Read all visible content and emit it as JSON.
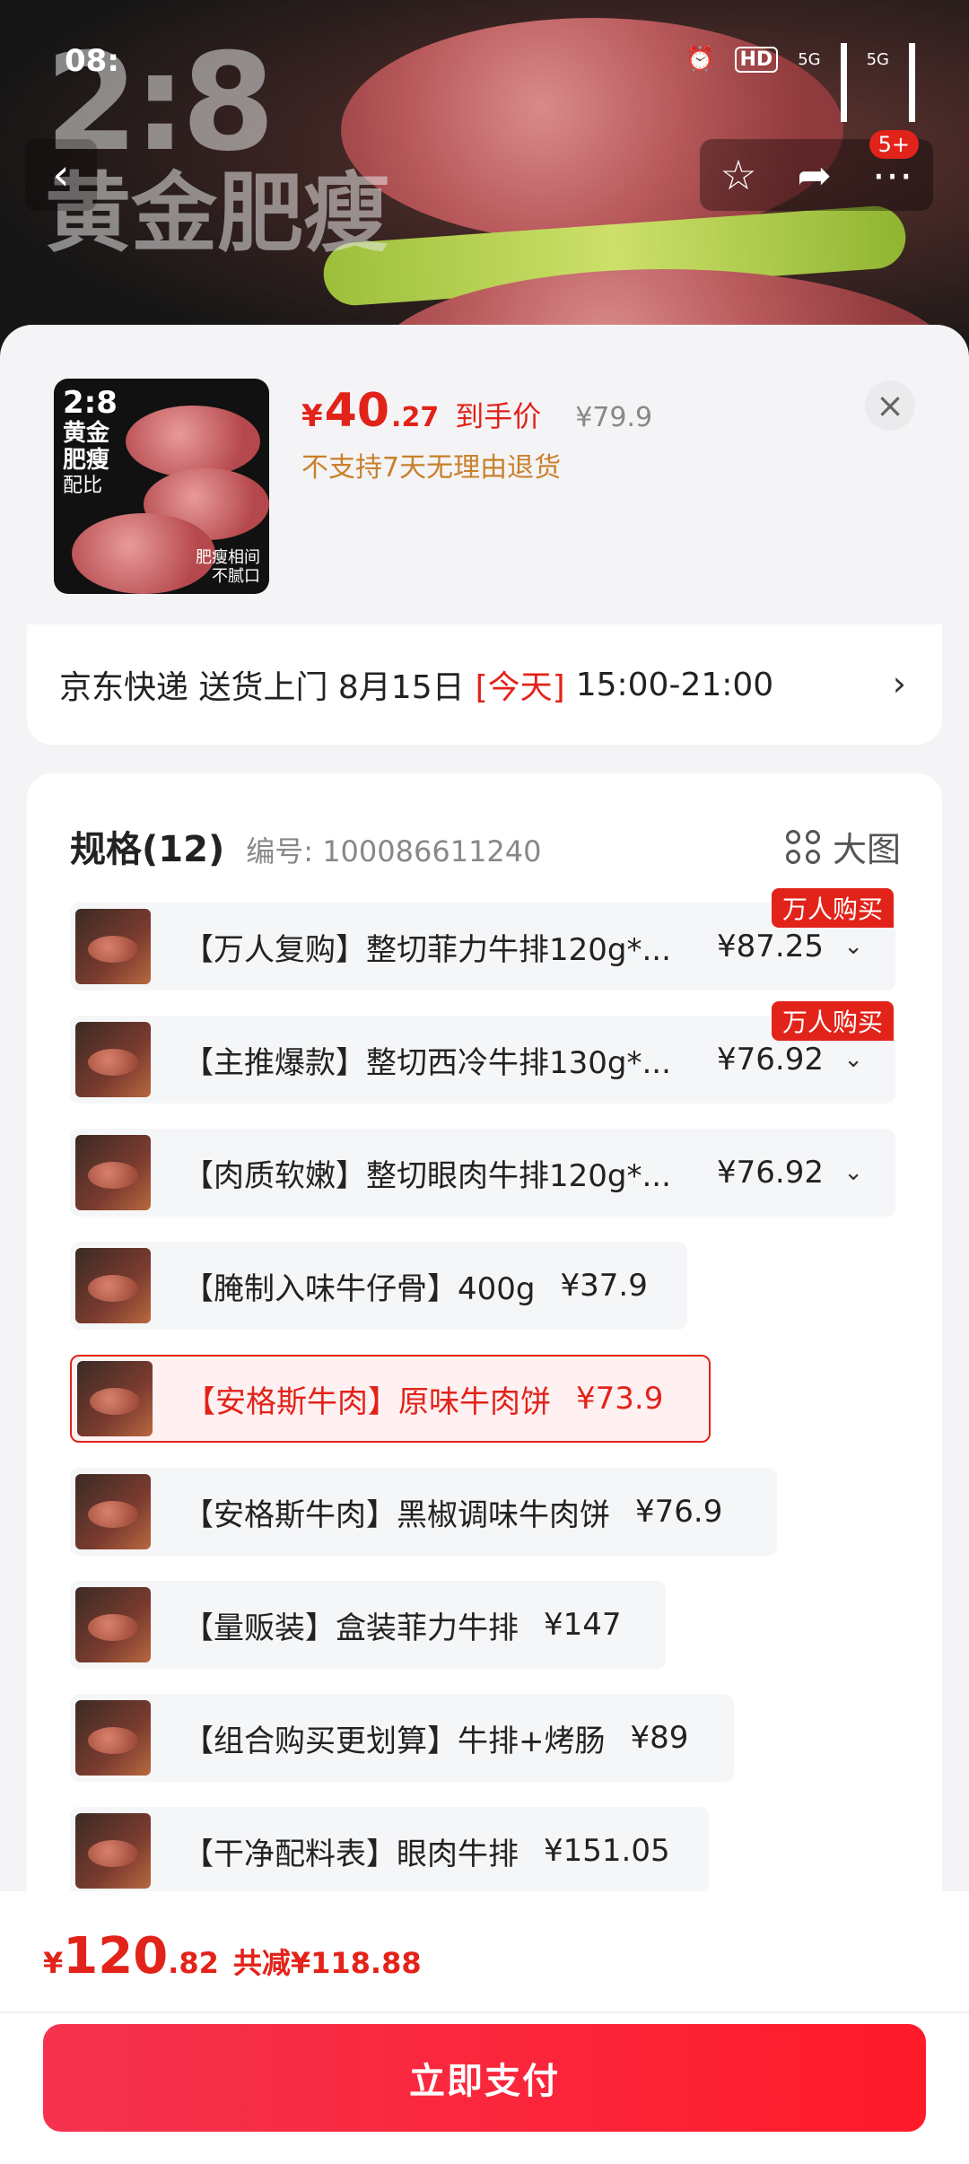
{
  "status_bar": {
    "time": "08:",
    "hd": "HD",
    "net1": "5G",
    "net2": "5G"
  },
  "hero": {
    "ratio": "2:8",
    "title": "黄金肥瘦"
  },
  "nav": {
    "back": "‹",
    "badge": "5+"
  },
  "summary": {
    "thumb_ratio": "2:8",
    "thumb_line1": "黄金",
    "thumb_line2": "肥瘦",
    "thumb_line3": "配比",
    "thumb_note_line1": "肥瘦相间",
    "thumb_note_line2": "不腻口",
    "price_symbol": "¥",
    "price_int": "40",
    "price_dec": ".27",
    "price_label": "到手价",
    "original_price": "¥79.9",
    "return_note": "不支持7天无理由退货",
    "close": "×"
  },
  "delivery": {
    "prefix": "京东快递 送货上门 8月15日",
    "today": "[今天]",
    "window": "15:00-21:00",
    "chevron": "›"
  },
  "specs": {
    "title": "规格(12)",
    "code": "编号: 100086611240",
    "big_view": "大图",
    "options": [
      {
        "name": "【万人复购】整切菲力牛排120g*...",
        "price": "¥87.25",
        "tag": "万人购买"
      },
      {
        "name": "【主推爆款】整切西冷牛排130g*...",
        "price": "¥76.92",
        "tag": "万人购买"
      },
      {
        "name": "【肉质软嫩】整切眼肉牛排120g*...",
        "price": "¥76.92"
      },
      {
        "name": "【腌制入味牛仔骨】400g",
        "price": "¥37.9"
      },
      {
        "name": "【安格斯牛肉】原味牛肉饼",
        "price": "¥73.9",
        "selected": true
      },
      {
        "name": "【安格斯牛肉】黑椒调味牛肉饼",
        "price": "¥76.9"
      },
      {
        "name": "【量贩装】盒装菲力牛排",
        "price": "¥147"
      },
      {
        "name": "【组合购买更划算】牛排+烤肠",
        "price": "¥89"
      },
      {
        "name": "【干净配料表】眼肉牛排",
        "price": "¥151.05"
      }
    ]
  },
  "footer": {
    "yen": "¥",
    "total_int": "120",
    "total_dec": ".82",
    "saving": "共减¥118.88",
    "pay_button": "立即支付"
  },
  "colors": {
    "accent": "#e2231a",
    "return_note": "#c9802b"
  }
}
